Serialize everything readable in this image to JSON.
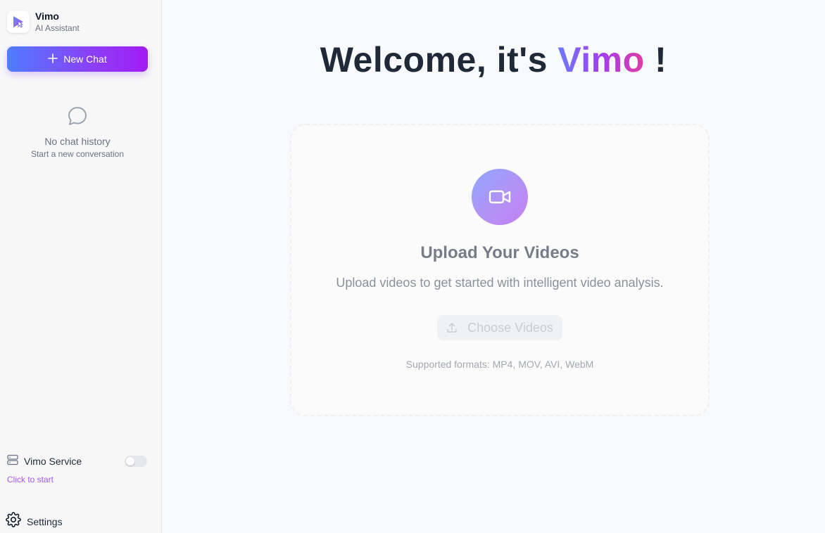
{
  "app": {
    "name": "Vimo",
    "subtitle": "AI Assistant"
  },
  "sidebar": {
    "new_chat_label": "New Chat",
    "empty_title": "No chat history",
    "empty_subtitle": "Start a new conversation",
    "service_label": "Vimo Service",
    "service_enabled": false,
    "service_hint": "Click to start",
    "settings_label": "Settings"
  },
  "main": {
    "welcome_prefix": "Welcome, it's",
    "welcome_brand": "Vimo",
    "welcome_suffix": "!",
    "upload_title": "Upload Your Videos",
    "upload_description": "Upload videos to get started with intelligent video analysis.",
    "choose_button_label": "Choose Videos",
    "supported_formats": "Supported formats: MP4, MOV, AVI, WebM"
  },
  "icons": {
    "logo": "play-cursor-logo",
    "new_chat": "plus-icon",
    "empty_history": "chat-bubble-icon",
    "service": "server-icon",
    "settings": "gear-icon",
    "upload_hero": "video-camera-icon",
    "choose_button": "upload-icon"
  },
  "colors": {
    "accent_start": "#4f7cff",
    "accent_end": "#a21cf5",
    "service_hint": "#a855f7"
  }
}
